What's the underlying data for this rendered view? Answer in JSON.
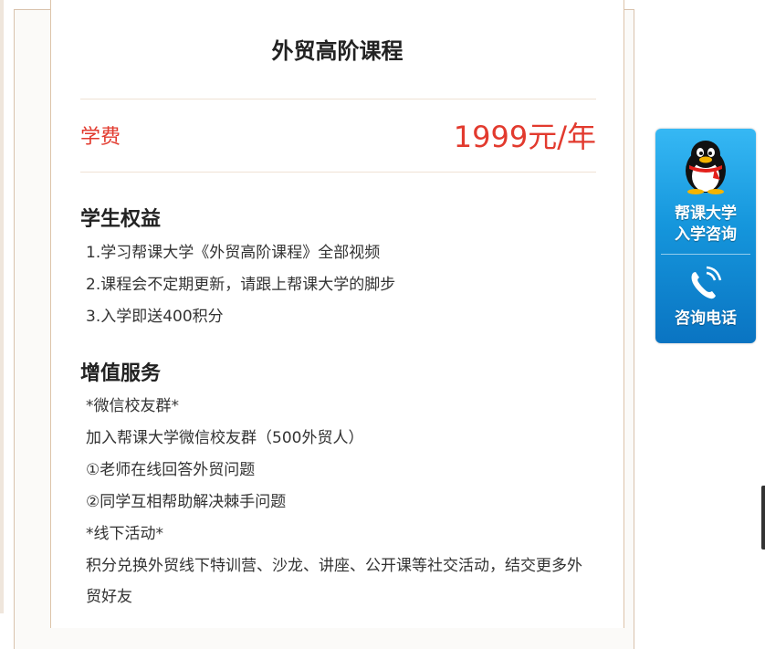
{
  "course": {
    "title": "外贸高阶课程",
    "fee_label": "学费",
    "fee_price": "1999元/年"
  },
  "benefits": {
    "heading": "学生权益",
    "items": [
      "1.学习帮课大学《外贸高阶课程》全部视频",
      "2.课程会不定期更新，请跟上帮课大学的脚步",
      "3.入学即送400积分"
    ]
  },
  "services": {
    "heading": "增值服务",
    "items": [
      "*微信校友群*",
      "加入帮课大学微信校友群（500外贸人）",
      "①老师在线回答外贸问题",
      "②同学互相帮助解决棘手问题",
      "*线下活动*",
      "积分兑换外贸线下特训营、沙龙、讲座、公开课等社交活动，结交更多外贸好友"
    ]
  },
  "side_widget": {
    "qq_line1": "帮课大学",
    "qq_line2": "入学咨询",
    "phone_label": "咨询电话",
    "colors": {
      "top": "#36b8f4",
      "bottom": "#0a74c2"
    }
  },
  "colors": {
    "accent": "#e23a2e",
    "frame": "#ddc4aa"
  }
}
